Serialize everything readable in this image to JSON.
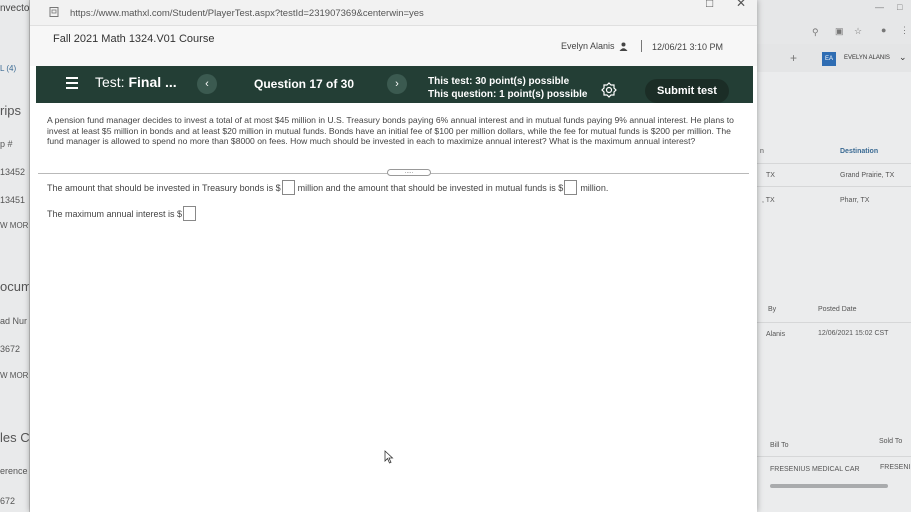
{
  "browser": {
    "url": "https://www.mathxl.com/Student/PlayerTest.aspx?testId=231907369&centerwin=yes"
  },
  "left_window": {
    "title": "nvector",
    "labels": [
      "L (4)",
      "rips",
      "p #",
      "13452",
      "13451",
      "W MOR",
      "ocum",
      "ad Nur",
      "3672",
      "W MOR",
      "les C",
      "erence",
      "672"
    ]
  },
  "right_window": {
    "initials": "EA",
    "user": "EVELYN ALANIS",
    "plus": "+",
    "col_n": "n",
    "col_destination": "Destination",
    "row1_state": "TX",
    "row1_dest": "Grand Prairie, TX",
    "row2_state": ", TX",
    "row2_dest": "Pharr, TX",
    "col_by": "By",
    "col_posted": "Posted Date",
    "by_value": "Alanis",
    "posted_value": "12/06/2021 15:02 CST",
    "col_bill_to": "Bill To",
    "col_sold_to": "Sold To",
    "bill_to_value": "FRESENIUS MEDICAL CAR",
    "sold_to_value": "FRESENI"
  },
  "course": {
    "name": "Fall 2021 Math 1324.V01 Course",
    "user": "Evelyn Alanis",
    "datetime": "12/06/21 3:10 PM"
  },
  "testbar": {
    "title_prefix": "Test: ",
    "title_name": "Final ...",
    "question": "Question 17 of 30",
    "prev": "‹",
    "next": "›",
    "test_points": "This test: 30 point(s) possible",
    "question_points": "This question: 1 point(s) possible",
    "submit": "Submit test"
  },
  "question": {
    "text": "A pension fund manager decides to invest a total of at most $45 million in U.S. Treasury bonds paying 6% annual interest and in mutual funds paying 9% annual interest. He plans to invest at least $5 million in bonds and at least $20 million in mutual funds. Bonds have an initial fee of $100 per million dollars, while the fee for mutual funds is $200 per million. The fund manager is allowed to spend no more than $8000 on fees. How much should be invested in each to maximize annual interest? What is the maximum annual interest?",
    "answer1_a": "The amount that should be invested in Treasury bonds is $",
    "answer1_b": "million and the amount that should be invested in mutual funds is $",
    "answer1_c": "million.",
    "answer2": "The maximum annual interest is $",
    "grip": "....."
  }
}
